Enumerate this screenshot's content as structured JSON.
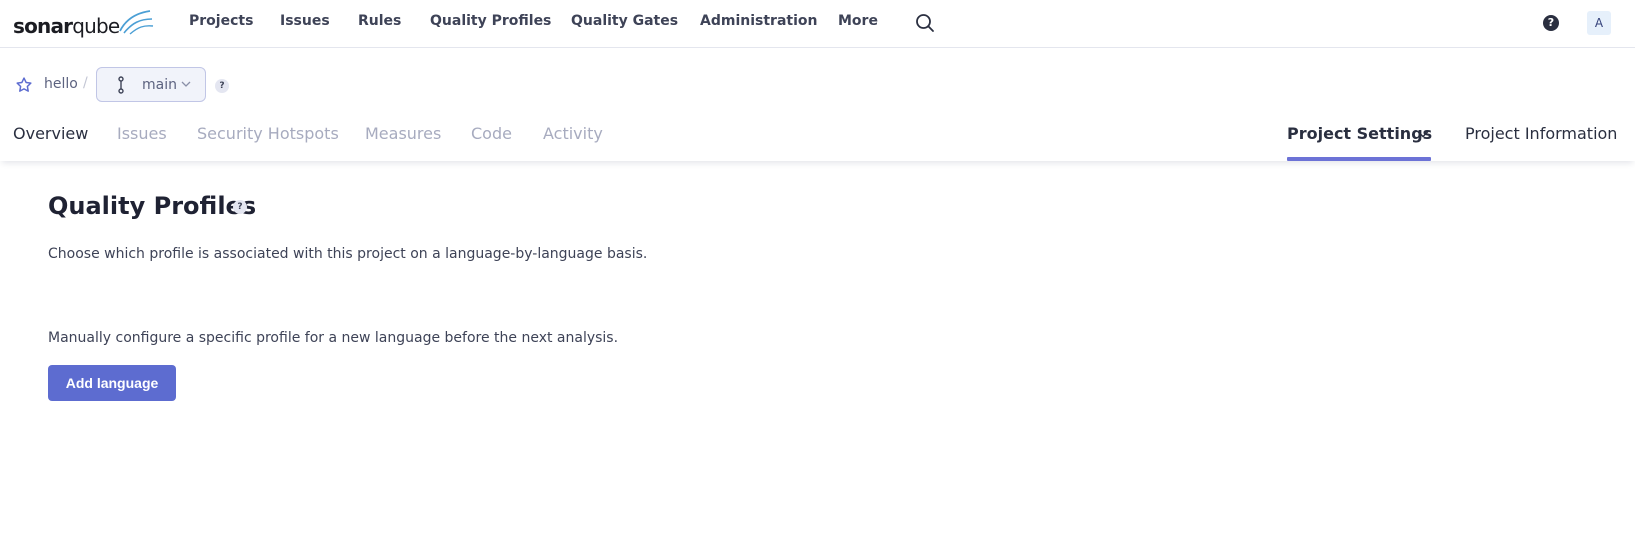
{
  "brand": {
    "logo_bold": "sonar",
    "logo_light": "qube"
  },
  "topnav": {
    "items": [
      "Projects",
      "Issues",
      "Rules",
      "Quality Profiles",
      "Quality Gates",
      "Administration",
      "More"
    ],
    "help_label": "?",
    "avatar_initial": "A"
  },
  "project": {
    "name": "hello",
    "separator": "/",
    "branch": "main",
    "help_label": "?"
  },
  "tabs": {
    "left": [
      "Overview",
      "Issues",
      "Security Hotspots",
      "Measures",
      "Code",
      "Activity"
    ],
    "settings": "Project Settings",
    "information": "Project Information"
  },
  "main": {
    "title": "Quality Profiles",
    "title_help": "?",
    "description": "Choose which profile is associated with this project on a language-by-language basis.",
    "manual_note": "Manually configure a specific profile for a new language before the next analysis.",
    "add_button": "Add language"
  },
  "colors": {
    "accent": "#5d6cd0",
    "tab_underline": "#6c72d6",
    "text_dark": "#2a2f40"
  }
}
